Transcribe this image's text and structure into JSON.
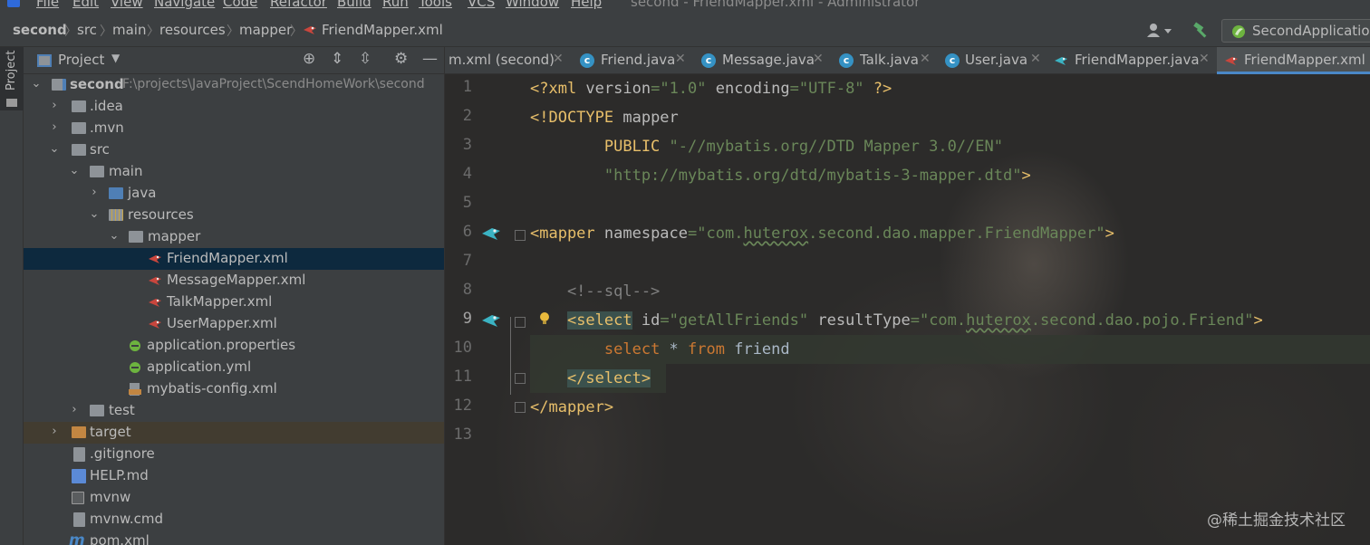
{
  "menu": {
    "items": [
      "File",
      "Edit",
      "View",
      "Navigate",
      "Code",
      "Refactor",
      "Build",
      "Run",
      "Tools",
      "VCS",
      "Window",
      "Help"
    ],
    "window_title": "second - FriendMapper.xml - Administrator"
  },
  "breadcrumb": [
    "second",
    "src",
    "main",
    "resources",
    "mapper",
    "FriendMapper.xml"
  ],
  "run_config": "SecondApplication",
  "left_strip": {
    "project_tab": "Project"
  },
  "project_panel": {
    "title": "Project",
    "tree": [
      {
        "label": "second",
        "path": "F:\\projects\\JavaProject\\ScendHomeWork\\second"
      },
      {
        "label": ".idea"
      },
      {
        "label": ".mvn"
      },
      {
        "label": "src"
      },
      {
        "label": "main"
      },
      {
        "label": "java"
      },
      {
        "label": "resources"
      },
      {
        "label": "mapper"
      },
      {
        "label": "FriendMapper.xml"
      },
      {
        "label": "MessageMapper.xml"
      },
      {
        "label": "TalkMapper.xml"
      },
      {
        "label": "UserMapper.xml"
      },
      {
        "label": "application.properties"
      },
      {
        "label": "application.yml"
      },
      {
        "label": "mybatis-config.xml"
      },
      {
        "label": "test"
      },
      {
        "label": "target"
      },
      {
        "label": ".gitignore"
      },
      {
        "label": "HELP.md"
      },
      {
        "label": "mvnw"
      },
      {
        "label": "mvnw.cmd"
      },
      {
        "label": "pom.xml"
      }
    ]
  },
  "tabs": [
    {
      "label": "m.xml (second)"
    },
    {
      "label": "Friend.java"
    },
    {
      "label": "Message.java"
    },
    {
      "label": "Talk.java"
    },
    {
      "label": "User.java"
    },
    {
      "label": "FriendMapper.java"
    },
    {
      "label": "FriendMapper.xml"
    }
  ],
  "editor": {
    "line_numbers": [
      "1",
      "2",
      "3",
      "4",
      "5",
      "6",
      "7",
      "8",
      "9",
      "10",
      "11",
      "12",
      "13"
    ],
    "code": {
      "l1_a": "<?xml ",
      "l1_b": "version",
      "l1_c": "=",
      "l1_d": "\"1.0\"",
      "l1_e": " encoding",
      "l1_f": "=",
      "l1_g": "\"UTF-8\"",
      "l1_h": " ?>",
      "l2_a": "<!DOCTYPE ",
      "l2_b": "mapper",
      "l3_a": "        PUBLIC ",
      "l3_b": "\"-//mybatis.org//DTD Mapper 3.0//EN\"",
      "l4_a": "        \"http://mybatis.org/dtd/mybatis-3-mapper.dtd\"",
      "l4_b": ">",
      "l6_a": "<mapper ",
      "l6_b": "namespace",
      "l6_c": "=",
      "l6_d": "\"com.",
      "l6_e": "huterox",
      "l6_f": ".second.dao.mapper.FriendMapper\"",
      "l6_g": ">",
      "l8_a": "    <!--sql-->",
      "l9_a": "    ",
      "l9_b": "<select",
      "l9_c": " id",
      "l9_d": "=",
      "l9_e": "\"getAllFriends\"",
      "l9_f": " resultType",
      "l9_g": "=",
      "l9_h": "\"com.",
      "l9_i": "huterox",
      "l9_j": ".second.dao.pojo.Friend\"",
      "l9_k": ">",
      "l10_a": "        ",
      "l10_b": "select",
      "l10_c": " * ",
      "l10_d": "from",
      "l10_e": " friend",
      "l11_a": "    ",
      "l11_b": "</select>",
      "l12_a": "</mapper>"
    }
  },
  "watermark": "@稀土掘金技术社区",
  "colors": {
    "accent": "#4a88c7",
    "selection": "#0d293e",
    "xml_tag": "#e8bf6a",
    "string": "#6a8759",
    "keyword": "#cc7832",
    "comment": "#808080"
  }
}
